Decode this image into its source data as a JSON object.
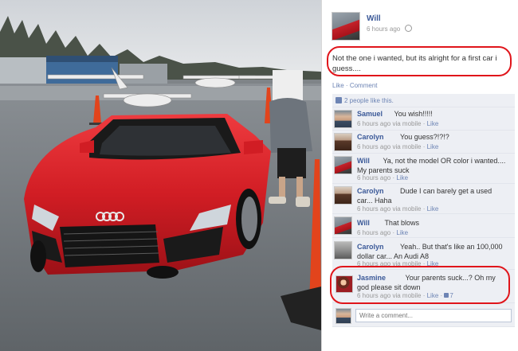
{
  "post": {
    "author": "Will",
    "timestamp": "6 hours ago",
    "caption": "Not the one i wanted, but its alright for a first car i guess....",
    "like_link": "Like",
    "comment_link": "Comment",
    "likes_count": "2 people like this."
  },
  "comments": [
    {
      "name": "Samuel",
      "text": "You wish!!!!!",
      "meta": "6 hours ago via mobile",
      "like": "Like"
    },
    {
      "name": "Carolyn",
      "text": "You guess?!?!?",
      "meta": "6 hours ago via mobile",
      "like": "Like"
    },
    {
      "name": "Will",
      "text": "Ya, not the model OR color i wanted.... My parents suck",
      "meta": "6 hours ago",
      "like": "Like"
    },
    {
      "name": "Carolyn",
      "text": "Dude I can barely get a used car... Haha",
      "meta": "6 hours ago via mobile",
      "like": "Like"
    },
    {
      "name": "Will",
      "text": "That blows",
      "meta": "6 hours ago",
      "like": "Like"
    },
    {
      "name": "Carolyn",
      "text": "Yeah.. But that's like an 100,000 dollar car... An Audi A8",
      "meta": "6 hours ago via mobile",
      "like": "Like"
    },
    {
      "name": "Jasmine",
      "text": "Your parents suck...? Oh my god please sit down",
      "meta": "6 hours ago via mobile",
      "like": "Like",
      "likes": "7"
    }
  ],
  "composer": {
    "placeholder": "Write a comment..."
  },
  "colors": {
    "link": "#3b5998",
    "annotation": "#e0151b",
    "car": "#d8232a"
  }
}
